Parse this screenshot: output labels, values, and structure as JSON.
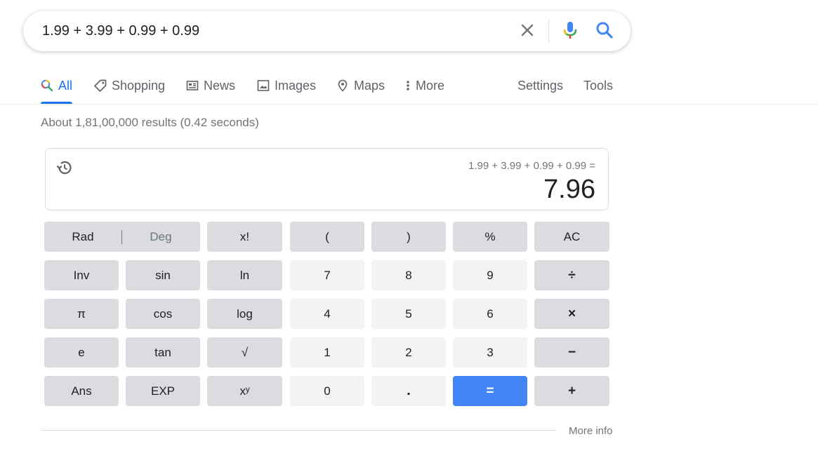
{
  "search": {
    "query": "1.99 + 3.99 + 0.99 + 0.99",
    "clear_icon": "close-icon",
    "mic_icon": "microphone-icon",
    "search_icon": "search-icon"
  },
  "tabs": [
    {
      "label": "All",
      "icon": "search-icon",
      "active": true
    },
    {
      "label": "Shopping",
      "icon": "tag-icon"
    },
    {
      "label": "News",
      "icon": "newspaper-icon"
    },
    {
      "label": "Images",
      "icon": "image-icon"
    },
    {
      "label": "Maps",
      "icon": "map-pin-icon"
    },
    {
      "label": "More",
      "icon": "more-vert-icon"
    }
  ],
  "tools": {
    "settings": "Settings",
    "tools": "Tools"
  },
  "result_stats": "About 1,81,00,000 results (0.42 seconds)",
  "calculator": {
    "expression": "1.99 + 3.99 + 0.99 + 0.99 =",
    "result": "7.96",
    "rad": "Rad",
    "deg": "Deg",
    "keys": {
      "fact": "x!",
      "lparen": "(",
      "rparen": ")",
      "percent": "%",
      "ac": "AC",
      "inv": "Inv",
      "sin": "sin",
      "ln": "ln",
      "k7": "7",
      "k8": "8",
      "k9": "9",
      "div": "÷",
      "pi": "π",
      "cos": "cos",
      "log": "log",
      "k4": "4",
      "k5": "5",
      "k6": "6",
      "mul": "×",
      "e": "e",
      "tan": "tan",
      "sqrt": "√",
      "k1": "1",
      "k2": "2",
      "k3": "3",
      "sub": "−",
      "ans": "Ans",
      "exp": "EXP",
      "pow": "xʸ",
      "k0": "0",
      "dot": ".",
      "eq": "=",
      "add": "+"
    }
  },
  "more_info": "More info",
  "colors": {
    "accent": "#1a73e8",
    "equals": "#4285f4",
    "fn_key": "#dadce0",
    "num_key": "#f1f3f4"
  }
}
